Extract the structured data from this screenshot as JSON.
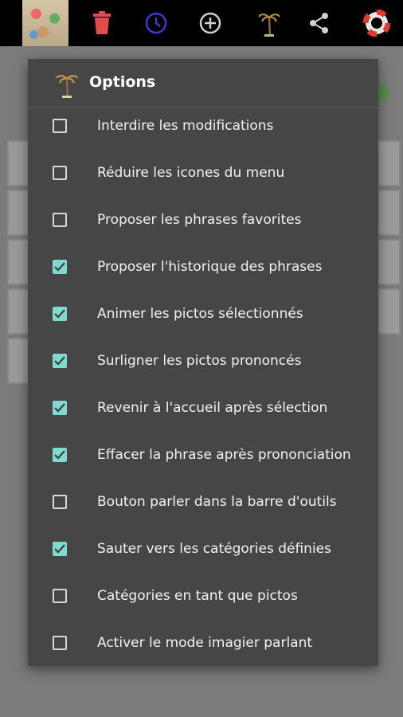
{
  "toolbar": {
    "icons": [
      "picture-thumbnail",
      "trash-icon",
      "history-icon",
      "add-icon",
      "palm-tree-icon",
      "share-icon",
      "help-lifebuoy-icon"
    ]
  },
  "dialog": {
    "title": "Options",
    "options": [
      {
        "label": "Interdire les modifications",
        "checked": false
      },
      {
        "label": "Réduire les icones du menu",
        "checked": false
      },
      {
        "label": "Proposer les phrases favorites",
        "checked": false
      },
      {
        "label": "Proposer l'historique des phrases",
        "checked": true
      },
      {
        "label": "Animer les pictos sélectionnés",
        "checked": true
      },
      {
        "label": "Surligner les pictos prononcés",
        "checked": true
      },
      {
        "label": "Revenir à l'accueil après sélection",
        "checked": true
      },
      {
        "label": "Effacer la phrase après prononciation",
        "checked": true
      },
      {
        "label": "Bouton parler dans la barre d'outils",
        "checked": false
      },
      {
        "label": "Sauter vers les catégories définies",
        "checked": true
      },
      {
        "label": "Catégories en tant que pictos",
        "checked": false
      },
      {
        "label": "Activer le mode imagier parlant",
        "checked": false
      }
    ]
  },
  "colors": {
    "toolbar_bg": "#000000",
    "dialog_bg": "#464646",
    "checkbox_checked": "#7fdad0",
    "trash": "#e24b4b",
    "history": "#3b3bd6"
  }
}
